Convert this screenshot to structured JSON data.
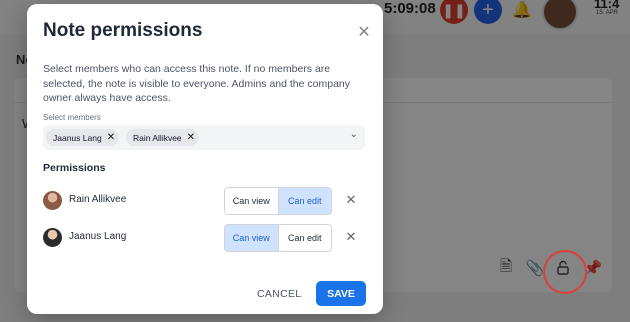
{
  "topbar": {
    "timer": "5:09:08",
    "clock": "11:4",
    "date": "15. APR"
  },
  "background": {
    "heading": "No",
    "letter": "W"
  },
  "modal": {
    "title": "Note permissions",
    "description": "Select members who can access this note. If no members are selected, the note is visible to everyone. Admins and the company owner always have access.",
    "select_label": "Select members",
    "selected_members": [
      "Jaanus Lang",
      "Rain Allikvee"
    ],
    "permissions_title": "Permissions",
    "members": [
      {
        "name": "Rain Allikvee",
        "permission": "Can edit"
      },
      {
        "name": "Jaanus Lang",
        "permission": "Can view"
      }
    ],
    "options": {
      "view": "Can view",
      "edit": "Can edit"
    },
    "cancel_label": "CANCEL",
    "save_label": "SAVE"
  },
  "colors": {
    "accent": "#1a73e8",
    "active_toggle_bg": "#cfe3ff",
    "highlight_circle": "#d9403a"
  }
}
